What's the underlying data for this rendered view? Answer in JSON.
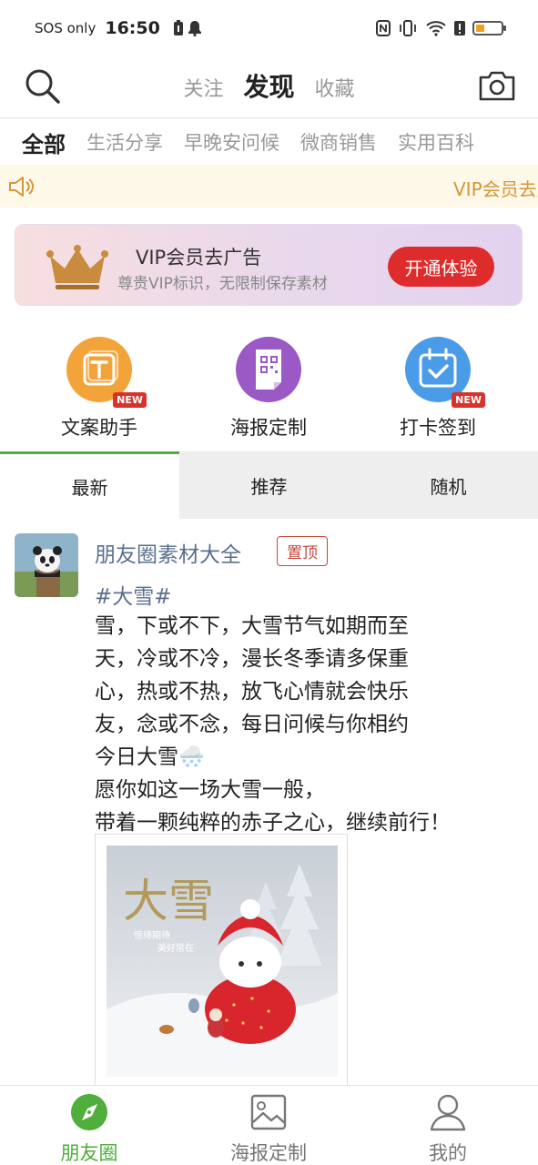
{
  "status_bar": {
    "carrier": "SOS only",
    "time": "16:50"
  },
  "header": {
    "tabs": [
      {
        "label": "关注",
        "active": false
      },
      {
        "label": "发现",
        "active": true
      },
      {
        "label": "收藏",
        "active": false
      }
    ]
  },
  "categories": [
    {
      "label": "全部",
      "active": true
    },
    {
      "label": "生活分享",
      "active": false
    },
    {
      "label": "早晚安问候",
      "active": false
    },
    {
      "label": "微商销售",
      "active": false
    },
    {
      "label": "实用百科",
      "active": false
    }
  ],
  "notice": {
    "text": "VIP会员去广告"
  },
  "vip_banner": {
    "title": "VIP会员去广告",
    "subtitle": "尊贵VIP标识，无限制保存素材",
    "button": "开通体验"
  },
  "tools": [
    {
      "label": "文案助手",
      "badge": "NEW",
      "icon": "text-icon",
      "color": "#f2a43a"
    },
    {
      "label": "海报定制",
      "badge": "",
      "icon": "qr-poster-icon",
      "color": "#9b59c6"
    },
    {
      "label": "打卡签到",
      "badge": "NEW",
      "icon": "calendar-check-icon",
      "color": "#4a9be8"
    }
  ],
  "feed_tabs": [
    {
      "label": "最新",
      "active": true
    },
    {
      "label": "推荐",
      "active": false
    },
    {
      "label": "随机",
      "active": false
    }
  ],
  "post": {
    "author": "朋友圈素材大全",
    "pin_label": "置顶",
    "hashtag": "#大雪#",
    "lines": [
      "雪，下或不下，大雪节气如期而至",
      "天，冷或不冷，漫长冬季请多保重",
      "心，热或不热，放飞心情就会快乐",
      "友，念或不念，每日问候与你相约",
      "今日大雪🌨️",
      "愿你如这一场大雪一般，",
      "带着一颗纯粹的赤子之心，继续前行！"
    ],
    "image": {
      "title": "大雪",
      "caption_1": "惊待期待",
      "caption_2": "美好常在"
    }
  },
  "bottom_nav": [
    {
      "label": "朋友圈",
      "active": true,
      "icon": "compass-icon"
    },
    {
      "label": "海报定制",
      "active": false,
      "icon": "image-icon"
    },
    {
      "label": "我的",
      "active": false,
      "icon": "user-icon"
    }
  ],
  "colors": {
    "accent_green": "#4fae3c",
    "link_blue": "#5a6f8f",
    "vip_red": "#de2c2c",
    "notice_text": "#d4963a"
  }
}
